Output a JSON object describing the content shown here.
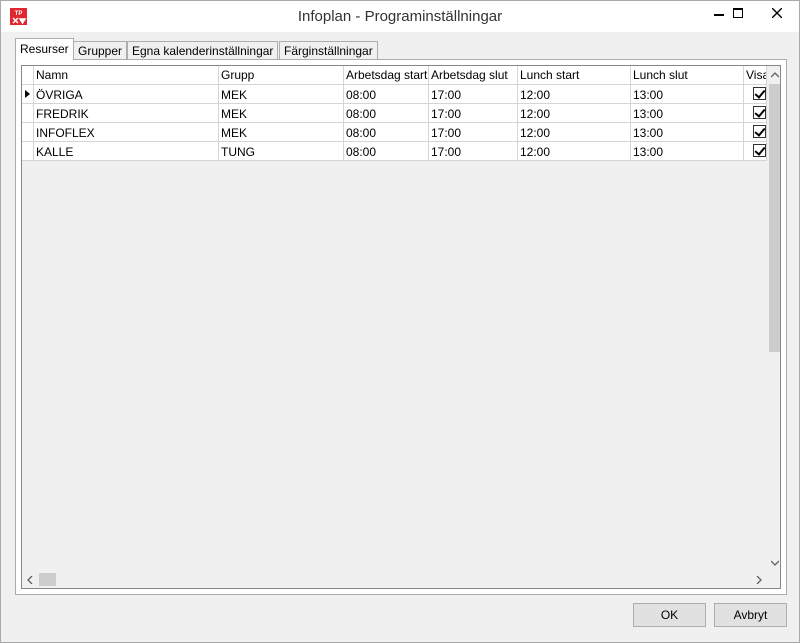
{
  "window": {
    "title": "Infoplan - Programinställningar",
    "app_icon_text": "TP",
    "controls": {
      "minimize": "—",
      "maximize": "□",
      "close": "✕"
    }
  },
  "tabs": [
    {
      "label": "Resurser",
      "active": true
    },
    {
      "label": "Grupper",
      "active": false
    },
    {
      "label": "Egna kalenderinställningar",
      "active": false
    },
    {
      "label": "Färginställningar",
      "active": false
    }
  ],
  "grid": {
    "columns": [
      "Namn",
      "Grupp",
      "Arbetsdag start",
      "Arbetsdag slut",
      "Lunch start",
      "Lunch slut",
      "Visa"
    ],
    "rows": [
      {
        "name": "ÖVRIGA",
        "group": "MEK",
        "work_start": "08:00",
        "work_end": "17:00",
        "lunch_start": "12:00",
        "lunch_end": "13:00",
        "visible": true,
        "current": true
      },
      {
        "name": "FREDRIK",
        "group": "MEK",
        "work_start": "08:00",
        "work_end": "17:00",
        "lunch_start": "12:00",
        "lunch_end": "13:00",
        "visible": true,
        "current": false
      },
      {
        "name": "INFOFLEX",
        "group": "MEK",
        "work_start": "08:00",
        "work_end": "17:00",
        "lunch_start": "12:00",
        "lunch_end": "13:00",
        "visible": true,
        "current": false
      },
      {
        "name": "KALLE",
        "group": "TUNG",
        "work_start": "08:00",
        "work_end": "17:00",
        "lunch_start": "12:00",
        "lunch_end": "13:00",
        "visible": true,
        "current": false
      }
    ]
  },
  "buttons": {
    "ok": "OK",
    "cancel": "Avbryt"
  },
  "colors": {
    "app_icon": "#e0262f"
  }
}
